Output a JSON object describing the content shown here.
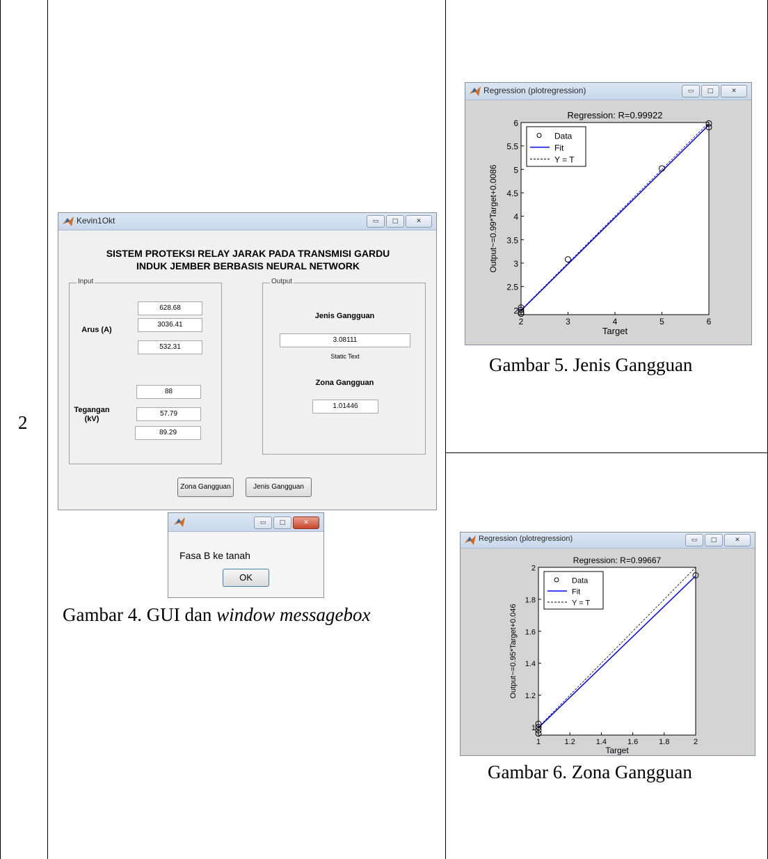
{
  "row_number": "2",
  "gui_window": {
    "title": "Kevin1Okt",
    "heading_line1": "SISTEM PROTEKSI RELAY JARAK PADA TRANSMISI GARDU",
    "heading_line2": "INDUK JEMBER BERBASIS NEURAL NETWORK",
    "input_panel_label": "Input",
    "output_panel_label": "Output",
    "arus_label": "Arus (A)",
    "arus_values": [
      "628.68",
      "3036.41",
      "532.31"
    ],
    "tegangan_label_line1": "Tegangan",
    "tegangan_label_line2": "(kV)",
    "tegangan_values": [
      "88",
      "57.79",
      "89.29"
    ],
    "jenis_gangguan_label": "Jenis Gangguan",
    "jenis_gangguan_value": "3.08111",
    "static_text": "Static Text",
    "zona_gangguan_label": "Zona Gangguan",
    "zona_gangguan_value": "1.01446",
    "zona_button": "Zona Gangguan",
    "jenis_button": "Jenis Gangguan"
  },
  "message_box": {
    "message": "Fasa B ke tanah",
    "ok_label": "OK"
  },
  "caption_4": {
    "prefix": "Gambar 4. GUI dan ",
    "italic": "window messagebox"
  },
  "caption_5": "Gambar 5. Jenis Gangguan",
  "caption_6": "Gambar 6. Zona Gangguan",
  "chart_data": [
    {
      "type": "scatter",
      "window_title": "Regression (plotregression)",
      "title": "Regression: R=0.99922",
      "xlabel": "Target",
      "ylabel": "Output~=0.99*Target+0.0086",
      "xlim": [
        2,
        6
      ],
      "ylim": [
        1.9,
        6
      ],
      "xticks": [
        "2",
        "3",
        "4",
        "5",
        "6"
      ],
      "yticks": [
        "2",
        "2.5",
        "3",
        "3.5",
        "4",
        "4.5",
        "5",
        "5.5",
        "6"
      ],
      "points": [
        [
          2,
          2.05
        ],
        [
          2,
          2.0
        ],
        [
          2,
          1.95
        ],
        [
          2,
          1.92
        ],
        [
          3,
          3.08
        ],
        [
          5,
          5.02
        ],
        [
          6,
          5.98
        ],
        [
          6,
          5.9
        ]
      ],
      "fit": {
        "slope": 0.99,
        "intercept": 0.0086
      },
      "legend": [
        "Data",
        "Fit",
        "Y = T"
      ],
      "legend_position": "top-left"
    },
    {
      "type": "scatter",
      "window_title": "Regression (plotregression)",
      "title": "Regression: R=0.99667",
      "xlabel": "Target",
      "ylabel": "Output~=0.95*Target+0.046",
      "xlim": [
        1,
        2
      ],
      "ylim": [
        0.95,
        2
      ],
      "xticks": [
        "1",
        "1.2",
        "1.4",
        "1.6",
        "1.8",
        "2"
      ],
      "yticks": [
        "1",
        "1.2",
        "1.4",
        "1.6",
        "1.8",
        "2"
      ],
      "points": [
        [
          1,
          1.02
        ],
        [
          1,
          1.0
        ],
        [
          1,
          0.98
        ],
        [
          1,
          0.96
        ],
        [
          2,
          1.95
        ]
      ],
      "fit": {
        "slope": 0.95,
        "intercept": 0.046
      },
      "legend": [
        "Data",
        "Fit",
        "Y = T"
      ],
      "legend_position": "top-left"
    }
  ]
}
